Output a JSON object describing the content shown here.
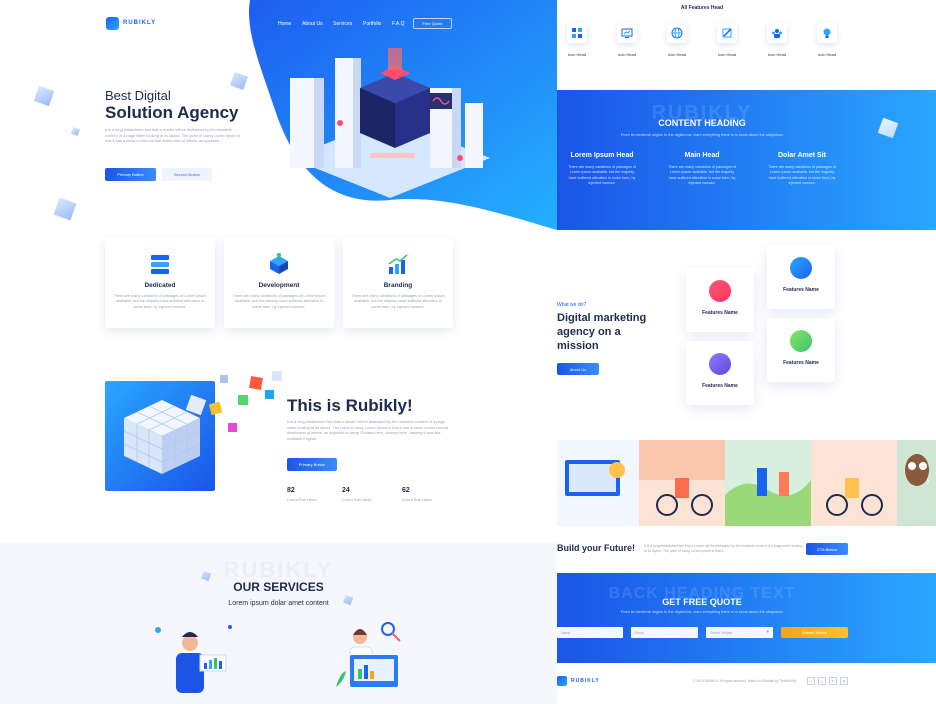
{
  "brand": {
    "name": "RUBIKLY"
  },
  "nav": {
    "items": [
      "Home",
      "About Us",
      "Services",
      "Portfolio",
      "F.A.Q"
    ],
    "cta": "Free Quote"
  },
  "hero": {
    "title_line1": "Best Digital",
    "title_line2": "Solution Agency",
    "body": "It is a long established fact that a reader will be distracted by the readable content of a page when looking at its layout. The point of using Lorem Ipsum is that it has a more-or-less normal distribution of letters, as opposed",
    "primary_button": "Primary Button",
    "secondary_button": "Second Button"
  },
  "features": [
    {
      "title": "Dedicated",
      "text": "There are many variations of passages of Lorem Ipsum available, but the majority have suffered alteration in some form, by injected humour."
    },
    {
      "title": "Development",
      "text": "There are many variations of passages of Lorem Ipsum available, but the majority have suffered alteration in some form, by injected humour."
    },
    {
      "title": "Branding",
      "text": "There are many variations of passages of Lorem Ipsum available, but the majority have suffered alteration in some form, by injected humour."
    }
  ],
  "about": {
    "title": "This is Rubikly!",
    "body": "It is a long established fact that a reader will be distracted by the readable content of a page when looking at its layout. The point of using Lorem Ipsum is that it has a more-or-less normal distribution of letters, as opposed to using 'Content here, content here', making it look like readable English.",
    "button": "Primary Button",
    "stats": [
      {
        "value": "82",
        "label": "Count Sub Head"
      },
      {
        "value": "24",
        "label": "Count Sub Head"
      },
      {
        "value": "62",
        "label": "Count Sub Head"
      }
    ]
  },
  "services": {
    "watermark": "RUBIKLY",
    "title": "OUR SERVICES",
    "subtitle": "Lorem ipsum dolar amet content"
  },
  "all_features": {
    "title": "All Features Head",
    "icons": [
      "Icon Head",
      "Icon Head",
      "Icon Head",
      "Icon Head",
      "Icon Head",
      "Icon Head"
    ]
  },
  "content": {
    "watermark": "RUBIKLY",
    "title": "CONTENT HEADING",
    "subtitle": "From its medieval origins to the digital era, learn everything there is to know about the ubiquitous",
    "columns": [
      {
        "title": "Lorem Ipsum Head",
        "text": "There are many variations of passages of Lorem Ipsum available, but the majority have suffered alteration in some form, by injected humour."
      },
      {
        "title": "Main Head",
        "text": "There are many variations of passages of Lorem Ipsum available, but the majority have suffered alteration in some form, by injected humour."
      },
      {
        "title": "Dolar Amet Sit",
        "text": "There are many variations of passages of Lorem Ipsum available, but the majority have suffered alteration in some form, by injected humour."
      }
    ]
  },
  "mission": {
    "eyebrow": "What we do?",
    "title_line1": "Digital marketing",
    "title_line2": "agency on a",
    "title_line3": "mission",
    "button": "About Us",
    "cards": [
      "Features Name",
      "Features Name",
      "Features Name",
      "Features Name"
    ]
  },
  "cta_band": {
    "title": "Build your Future!",
    "text": "It is a long established fact that a reader will be distracted by the readable content of a page when looking at its layout. The point of using Lorem Ipsum is that it.",
    "button": "CTA Button"
  },
  "quote": {
    "watermark": "BACK HEADING TEXT",
    "title": "GET FREE QUOTE",
    "subtitle": "From its medieval origins to the digital era, learn everything there is to know about the ubiquitous",
    "name_placeholder": "Name",
    "email_placeholder": "Email",
    "select_placeholder": "Select Subject",
    "submit": "Submit Button"
  },
  "footer": {
    "brand": "RUBIKLY",
    "copyright": "© 2019 RUBIKLY. All rights reserved. Made for Dribbble by TheMeDNA",
    "social": [
      "f",
      "t",
      "in",
      "ig"
    ]
  },
  "colors": {
    "primary": "#1a63ef",
    "accent": "#2aa7ff",
    "orange": "#f7a21b",
    "dark": "#1d2b4c"
  }
}
